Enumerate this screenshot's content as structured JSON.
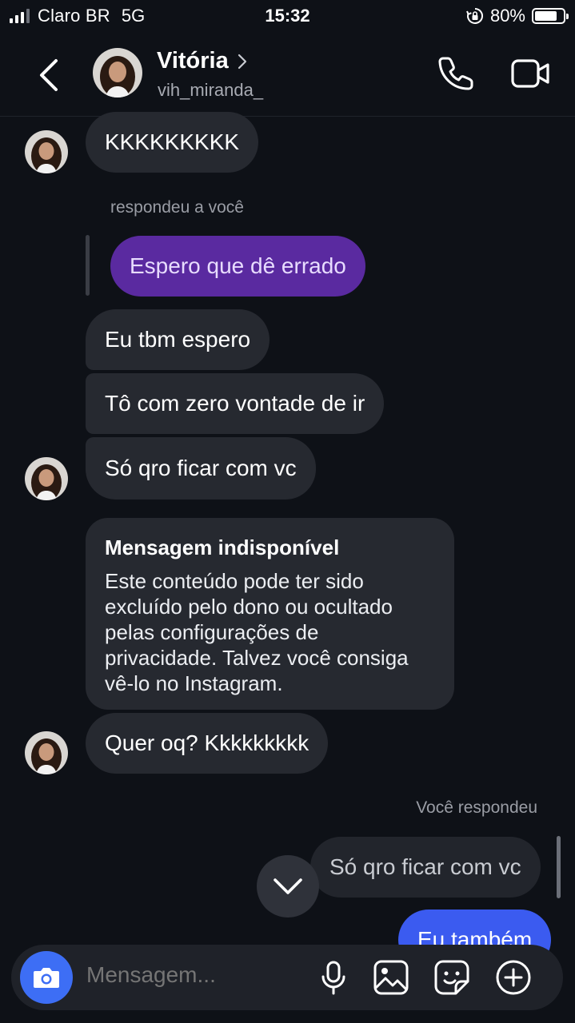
{
  "status_bar": {
    "carrier": "Claro BR",
    "network": "5G",
    "time": "15:32",
    "battery_percent": "80%",
    "battery_level": 0.8,
    "signal_bars": 3,
    "icons": [
      "signal-icon",
      "rotation-lock-icon",
      "battery-icon"
    ]
  },
  "header": {
    "name": "Vitória",
    "username": "vih_miranda_",
    "icons": [
      "back-chevron-icon",
      "chevron-right-icon",
      "phone-icon",
      "video-camera-icon"
    ]
  },
  "messages": [
    {
      "sender": "them",
      "text": "KKKKKKKKK"
    },
    {
      "sender": "meta",
      "text": "respondeu a você"
    },
    {
      "sender": "me",
      "text": "Espero que dê errado"
    },
    {
      "sender": "them",
      "text": "Eu tbm espero"
    },
    {
      "sender": "them",
      "text": "Tô com zero vontade de ir"
    },
    {
      "sender": "them",
      "text": "Só qro ficar com vc"
    },
    {
      "sender": "them",
      "type": "unavailable",
      "title": "Mensagem indisponível",
      "body": "Este conteúdo pode ter sido\nexcluído pelo dono ou ocultado\npelas configurações de\nprivacidade. Talvez você consiga\nvê-lo no Instagram."
    },
    {
      "sender": "them",
      "text": "Quer oq? Kkkkkkkkk"
    },
    {
      "sender": "meta",
      "text": "Você respondeu"
    },
    {
      "sender": "me",
      "text": "Só qro ficar com vc"
    },
    {
      "sender": "me",
      "text": "Eu também"
    }
  ],
  "composer": {
    "placeholder": "Mensagem...",
    "icons": [
      "camera-icon",
      "microphone-icon",
      "gallery-icon",
      "sticker-icon",
      "plus-circle-icon"
    ]
  },
  "colors": {
    "background": "#0e1117",
    "incoming_bubble": "#262930",
    "outgoing_purple": "#5a2aa0",
    "outgoing_blue": "#3b5bf0",
    "camera_button": "#3d6ef5"
  }
}
